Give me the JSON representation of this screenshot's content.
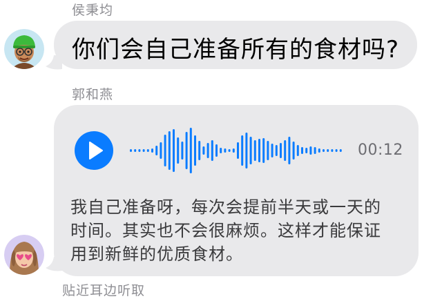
{
  "messages": [
    {
      "sender": "侯秉均",
      "avatar_icon": "memoji-man-green-beanie-icon",
      "text": "你们会自己准备所有的食材吗?"
    },
    {
      "sender": "郭和燕",
      "avatar_icon": "memoji-woman-heart-glasses-icon",
      "voice": {
        "play_icon": "play-icon",
        "duration": "00:12",
        "transcript_lines": [
          "我自己准备呀，每次会提前半天或一天的",
          "时间。其实也不会很麻烦。这样才能保证",
          "用到新鲜的优质食材。"
        ]
      }
    }
  ],
  "listen_hint": "贴近耳边听取",
  "colors": {
    "bubble": "#e9e9eb",
    "accent": "#0a7cff",
    "secondary_text": "#8e8e93"
  }
}
